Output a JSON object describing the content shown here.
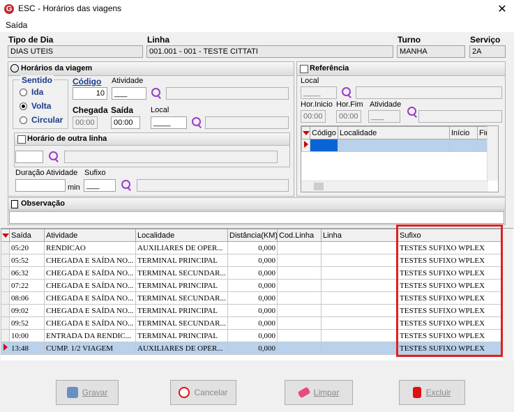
{
  "window": {
    "title": "ESC - Horários das viagens",
    "app_icon_letter": "G",
    "close_glyph": "✕"
  },
  "menu": {
    "saida": "Saída"
  },
  "header": {
    "tipo_dia_label": "Tipo de Dia",
    "tipo_dia_value": "DIAS UTEIS",
    "linha_label": "Linha",
    "linha_value": "001.001 - 001 - TESTE CITTATI",
    "turno_label": "Turno",
    "turno_value": "MANHA",
    "servico_label": "Serviço",
    "servico_value": "2A"
  },
  "horarios": {
    "title": "Horários da viagem",
    "sentido_label": "Sentido",
    "options": [
      "Ida",
      "Volta",
      "Circular"
    ],
    "selected": "Volta",
    "codigo_label": "Código",
    "codigo_value": "10",
    "atividade_label": "Atividade",
    "atividade_value": "___",
    "chegada_label": "Chegada",
    "chegada_value": "00:00",
    "saida_label": "Saída",
    "saida_value": "00:00",
    "local_label": "Local",
    "local_value": "____",
    "outra_linha_label": "Horário de outra linha",
    "duracao_label": "Duração Atividade",
    "min_label": "min",
    "sufixo_label": "Sufixo",
    "sufixo_value": "___"
  },
  "referencia": {
    "title": "Referência",
    "local_label": "Local",
    "local_value": "____",
    "hor_inicio_label": "Hor.Inicio",
    "hor_inicio_value": "00:00",
    "hor_fim_label": "Hor.Fim",
    "hor_fim_value": "00:00",
    "atividade_label": "Atividade",
    "atividade_value": "___",
    "grid_headers": [
      "Código",
      "Localidade",
      "Início",
      "Fir"
    ]
  },
  "observacao": {
    "title": "Observação",
    "value": ""
  },
  "grid": {
    "headers": [
      "Saída",
      "Atividade",
      "Localidade",
      "Distância(KM)",
      "Cod.Linha",
      "Linha",
      "Sufixo"
    ],
    "rows": [
      [
        "05:20",
        "RENDICAO",
        "AUXILIARES DE OPER...",
        "0,000",
        "",
        "",
        "TESTES SUFIXO WPLEX"
      ],
      [
        "05:52",
        "CHEGADA E SAÍDA NO...",
        "TERMINAL PRINCIPAL",
        "0,000",
        "",
        "",
        "TESTES SUFIXO WPLEX"
      ],
      [
        "06:32",
        "CHEGADA E SAÍDA NO...",
        "TERMINAL SECUNDAR...",
        "0,000",
        "",
        "",
        "TESTES SUFIXO WPLEX"
      ],
      [
        "07:22",
        "CHEGADA E SAÍDA NO...",
        "TERMINAL PRINCIPAL",
        "0,000",
        "",
        "",
        "TESTES SUFIXO WPLEX"
      ],
      [
        "08:06",
        "CHEGADA E SAÍDA NO...",
        "TERMINAL SECUNDAR...",
        "0,000",
        "",
        "",
        "TESTES SUFIXO WPLEX"
      ],
      [
        "09:02",
        "CHEGADA E SAÍDA NO...",
        "TERMINAL PRINCIPAL",
        "0,000",
        "",
        "",
        "TESTES SUFIXO WPLEX"
      ],
      [
        "09:52",
        "CHEGADA E SAÍDA NO...",
        "TERMINAL SECUNDAR...",
        "0,000",
        "",
        "",
        "TESTES SUFIXO WPLEX"
      ],
      [
        "10:00",
        "ENTRADA DA RENDIC...",
        "TERMINAL PRINCIPAL",
        "0,000",
        "",
        "",
        "TESTES SUFIXO WPLEX"
      ],
      [
        "13:48",
        "CUMP. 1/2 VIAGEM",
        "AUXILIARES DE OPER...",
        "0,000",
        "",
        "",
        "TESTES SUFIXO WPLEX"
      ]
    ],
    "selected_row": 8
  },
  "buttons": {
    "gravar": "Gravar",
    "cancelar": "Cancelar",
    "limpar": "Limpar",
    "excluir": "Excluir"
  },
  "colors": {
    "highlight_border": "#e02020",
    "selection": "#b9d1ea",
    "icon_purple": "#9a3bc9"
  }
}
